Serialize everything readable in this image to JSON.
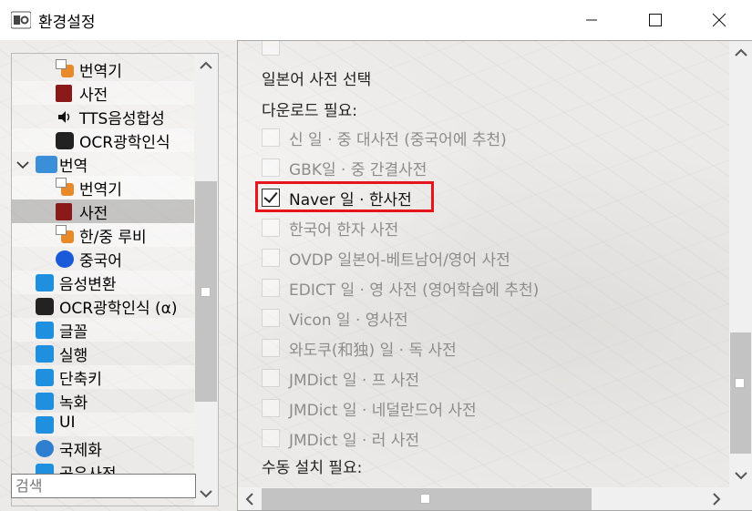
{
  "window": {
    "title": "환경설정",
    "minimize_glyph": "—",
    "maximize_glyph": "☐",
    "close_glyph": "✕"
  },
  "tree": {
    "items": [
      {
        "label": "번역기",
        "icon": "translator-icon",
        "indent": 2
      },
      {
        "label": "사전",
        "icon": "dictionary-icon",
        "indent": 2
      },
      {
        "label": "TTS음성합성",
        "icon": "speaker-icon",
        "indent": 2
      },
      {
        "label": "OCR광학인식",
        "icon": "ocr-icon",
        "indent": 2
      },
      {
        "label": "번역",
        "icon": "translation-group-icon",
        "indent": 1,
        "expanded": true
      },
      {
        "label": "번역기",
        "icon": "translator-icon",
        "indent": 2
      },
      {
        "label": "사전",
        "icon": "dictionary-icon",
        "indent": 2,
        "selected": true
      },
      {
        "label": "한/중 루비",
        "icon": "translator-icon",
        "indent": 2
      },
      {
        "label": "중국어",
        "icon": "sun-icon",
        "indent": 2
      },
      {
        "label": "음성변환",
        "icon": "music-icon",
        "indent": 1
      },
      {
        "label": "OCR광학인식 (α)",
        "icon": "ocr-icon",
        "indent": 1
      },
      {
        "label": "글꼴",
        "icon": "document-icon",
        "indent": 1
      },
      {
        "label": "실행",
        "icon": "app-store-icon",
        "indent": 1
      },
      {
        "label": "단축키",
        "icon": "shortcut-icon",
        "indent": 1
      },
      {
        "label": "녹화",
        "icon": "record-icon",
        "indent": 1
      },
      {
        "label": "UI",
        "icon": "monitor-icon",
        "indent": 1
      },
      {
        "label": "국제화",
        "icon": "globe-icon",
        "indent": 1
      }
    ],
    "partial_last": "공유사전"
  },
  "search": {
    "placeholder": "검색"
  },
  "panel": {
    "section_title": "일본어 사전 선택",
    "download_heading": "다운로드 필요:",
    "manual_heading": "수동 설치 필요:",
    "options": [
      {
        "label": "신 일 · 중 대사전 (중국어에 추천)",
        "checked": false,
        "enabled": false
      },
      {
        "label": "GBK일 · 중 간결사전",
        "checked": false,
        "enabled": false
      },
      {
        "label": "Naver 일 · 한사전",
        "checked": true,
        "enabled": true,
        "highlighted": true
      },
      {
        "label": "한국어 한자 사전",
        "checked": false,
        "enabled": false
      },
      {
        "label": "OVDP 일본어-베트남어/영어 사전",
        "checked": false,
        "enabled": false
      },
      {
        "label": "EDICT 일 · 영 사전 (영어학습에 추천)",
        "checked": false,
        "enabled": false
      },
      {
        "label": "Vicon 일 · 영사전",
        "checked": false,
        "enabled": false
      },
      {
        "label": "와도쿠(和独) 일 · 독 사전",
        "checked": false,
        "enabled": false
      },
      {
        "label": "JMDict 일 · 프 사전",
        "checked": false,
        "enabled": false
      },
      {
        "label": "JMDict 일 · 네덜란드어 사전",
        "checked": false,
        "enabled": false
      },
      {
        "label": "JMDict 일 · 러 사전",
        "checked": false,
        "enabled": false
      }
    ]
  },
  "scroll_glyphs": {
    "up": "▲",
    "down": "▼",
    "left": "◀",
    "right": "▶",
    "expand": "⌄"
  }
}
